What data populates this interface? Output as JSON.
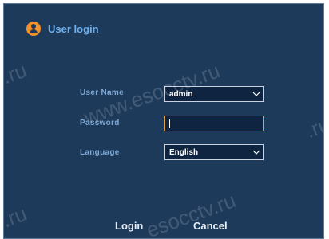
{
  "dialog": {
    "title": "User login",
    "title_icon": "user-icon",
    "form": {
      "user_name_label": "User Name",
      "user_name_value": "admin",
      "password_label": "Password",
      "password_value": "",
      "language_label": "Language",
      "language_value": "English"
    },
    "buttons": {
      "login": "Login",
      "cancel": "Cancel"
    }
  },
  "watermark": {
    "text_1": "www.esocctv.ru",
    "text_2": "esocctv.ru",
    "text_3": ".ru"
  },
  "colors": {
    "background": "#1d3a5b",
    "title": "#6fb1ee",
    "label": "#7ea9d6",
    "icon": "#f0922b",
    "focus_border": "#d7a24a"
  }
}
